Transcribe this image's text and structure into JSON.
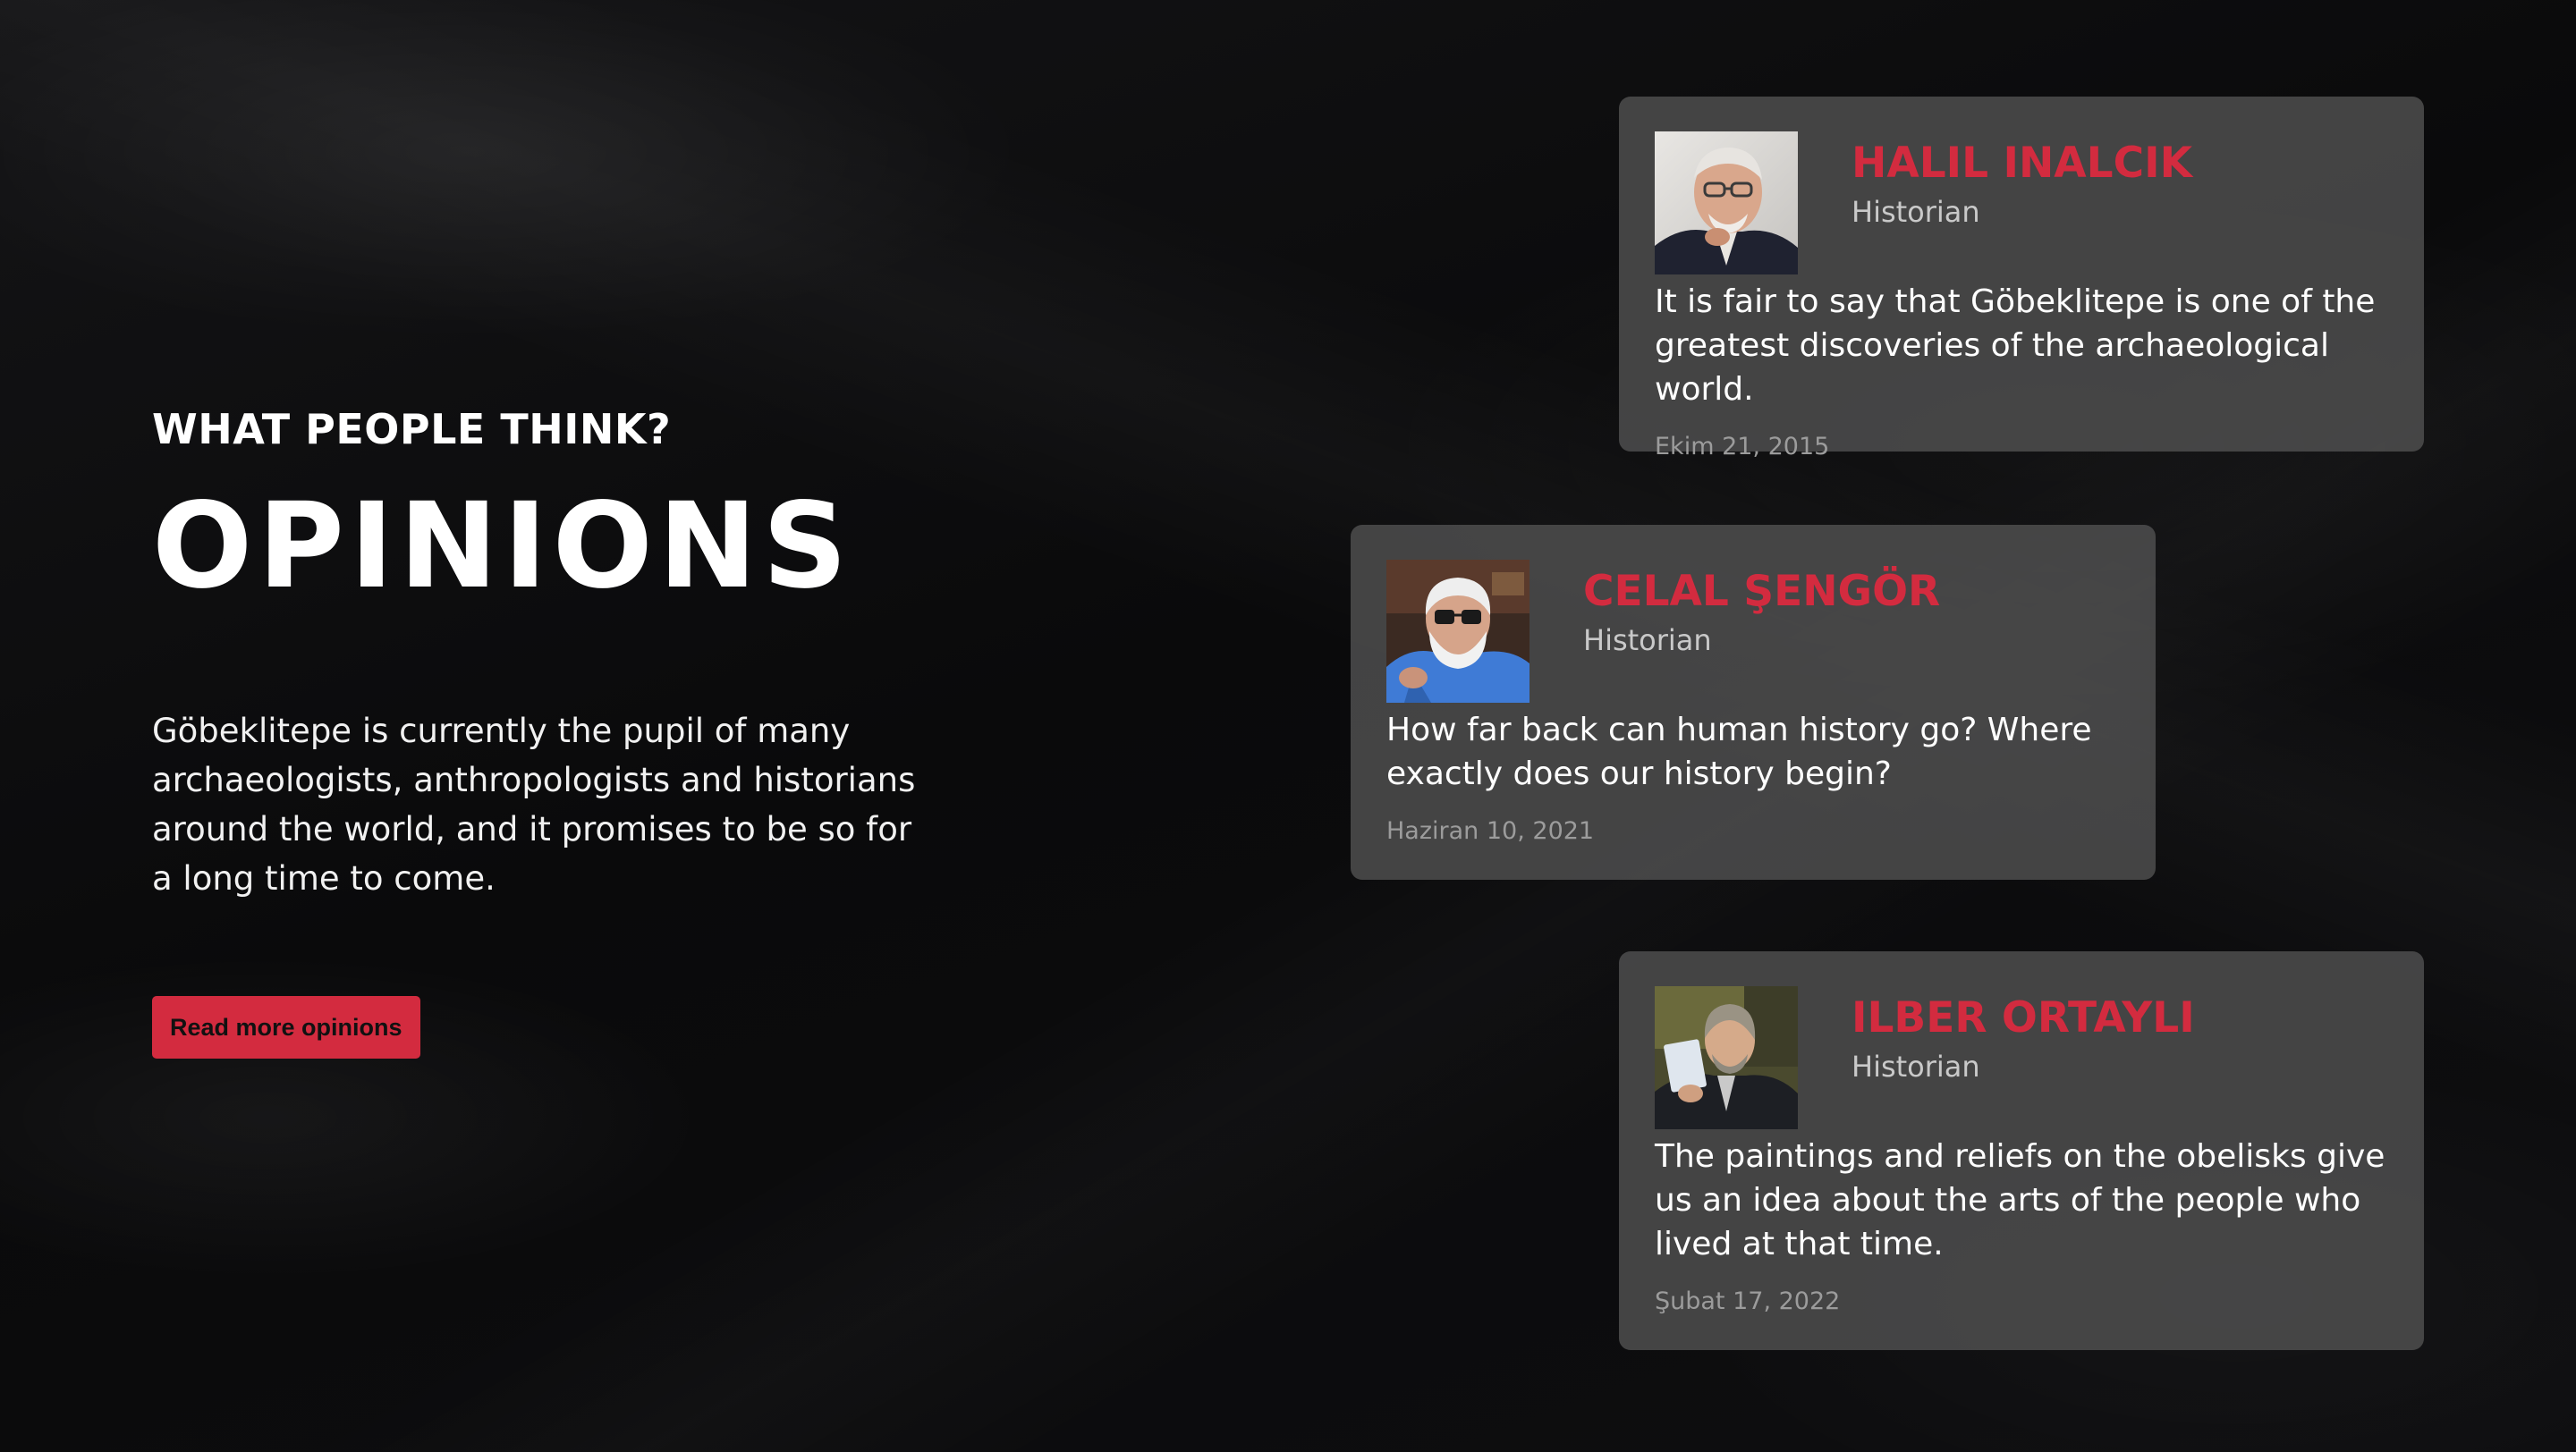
{
  "section": {
    "eyebrow": "WHAT PEOPLE THINK?",
    "title": "OPINIONS",
    "description": "Göbeklitepe is currently the pupil of many archaeologists, anthropologists and historians around the world, and it promises to be so for a long time to come.",
    "button_label": "Read more opinions"
  },
  "opinions": [
    {
      "name": "HALIL INALCIK",
      "role": "Historian",
      "quote": "It is fair to say that Göbeklitepe is one of the greatest discoveries of the archaeological world.",
      "date": "Ekim 21, 2015"
    },
    {
      "name": "CELAL ŞENGÖR",
      "role": "Historian",
      "quote": "How far back can human history go? Where exactly does our history begin?",
      "date": "Haziran 10, 2021"
    },
    {
      "name": "ILBER ORTAYLI",
      "role": "Historian",
      "quote": "The paintings and reliefs on the obelisks give us an idea about the arts of the people who lived at that time.",
      "date": "Şubat 17, 2022"
    }
  ],
  "colors": {
    "accent": "#d32b3f",
    "background": "#0b0b0c",
    "card": "#505050"
  }
}
